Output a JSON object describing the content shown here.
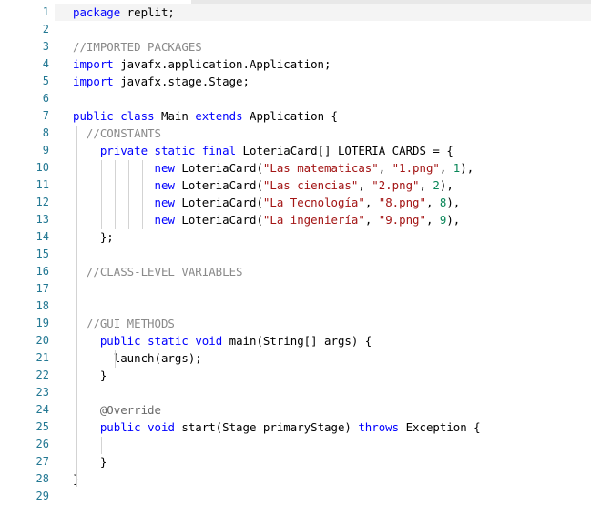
{
  "editor": {
    "line_numbers": [
      "1",
      "2",
      "3",
      "4",
      "5",
      "6",
      "7",
      "8",
      "9",
      "10",
      "11",
      "12",
      "13",
      "14",
      "15",
      "16",
      "17",
      "18",
      "19",
      "20",
      "21",
      "22",
      "23",
      "24",
      "25",
      "26",
      "27",
      "28",
      "29"
    ],
    "lines": [
      {
        "n": 1,
        "tokens": [
          {
            "t": "package",
            "k": "kw"
          },
          {
            "t": " replit;",
            "k": "plain"
          }
        ]
      },
      {
        "n": 2,
        "tokens": []
      },
      {
        "n": 3,
        "tokens": [
          {
            "t": "//IMPORTED PACKAGES",
            "k": "cm"
          }
        ]
      },
      {
        "n": 4,
        "tokens": [
          {
            "t": "import",
            "k": "kw"
          },
          {
            "t": " javafx.application.Application;",
            "k": "plain"
          }
        ]
      },
      {
        "n": 5,
        "tokens": [
          {
            "t": "import",
            "k": "kw"
          },
          {
            "t": " javafx.stage.Stage;",
            "k": "plain"
          }
        ]
      },
      {
        "n": 6,
        "tokens": []
      },
      {
        "n": 7,
        "tokens": [
          {
            "t": "public",
            "k": "kw"
          },
          {
            "t": " ",
            "k": "plain"
          },
          {
            "t": "class",
            "k": "kw"
          },
          {
            "t": " Main ",
            "k": "plain"
          },
          {
            "t": "extends",
            "k": "kw"
          },
          {
            "t": " Application {",
            "k": "plain"
          }
        ]
      },
      {
        "n": 8,
        "tokens": [
          {
            "t": "  //CONSTANTS",
            "k": "cm"
          }
        ]
      },
      {
        "n": 9,
        "tokens": [
          {
            "t": "    ",
            "k": "plain"
          },
          {
            "t": "private",
            "k": "kw"
          },
          {
            "t": " ",
            "k": "plain"
          },
          {
            "t": "static",
            "k": "kw"
          },
          {
            "t": " ",
            "k": "plain"
          },
          {
            "t": "final",
            "k": "kw"
          },
          {
            "t": " LoteriaCard[] LOTERIA_CARDS = {",
            "k": "plain"
          }
        ]
      },
      {
        "n": 10,
        "tokens": [
          {
            "t": "            ",
            "k": "plain"
          },
          {
            "t": "new",
            "k": "kw"
          },
          {
            "t": " LoteriaCard(",
            "k": "plain"
          },
          {
            "t": "\"Las matematicas\"",
            "k": "str"
          },
          {
            "t": ", ",
            "k": "plain"
          },
          {
            "t": "\"1.png\"",
            "k": "str"
          },
          {
            "t": ", ",
            "k": "plain"
          },
          {
            "t": "1",
            "k": "num"
          },
          {
            "t": "),",
            "k": "plain"
          }
        ]
      },
      {
        "n": 11,
        "tokens": [
          {
            "t": "            ",
            "k": "plain"
          },
          {
            "t": "new",
            "k": "kw"
          },
          {
            "t": " LoteriaCard(",
            "k": "plain"
          },
          {
            "t": "\"Las ciencias\"",
            "k": "str"
          },
          {
            "t": ", ",
            "k": "plain"
          },
          {
            "t": "\"2.png\"",
            "k": "str"
          },
          {
            "t": ", ",
            "k": "plain"
          },
          {
            "t": "2",
            "k": "num"
          },
          {
            "t": "),",
            "k": "plain"
          }
        ]
      },
      {
        "n": 12,
        "tokens": [
          {
            "t": "            ",
            "k": "plain"
          },
          {
            "t": "new",
            "k": "kw"
          },
          {
            "t": " LoteriaCard(",
            "k": "plain"
          },
          {
            "t": "\"La Tecnología\"",
            "k": "str"
          },
          {
            "t": ", ",
            "k": "plain"
          },
          {
            "t": "\"8.png\"",
            "k": "str"
          },
          {
            "t": ", ",
            "k": "plain"
          },
          {
            "t": "8",
            "k": "num"
          },
          {
            "t": "),",
            "k": "plain"
          }
        ]
      },
      {
        "n": 13,
        "tokens": [
          {
            "t": "            ",
            "k": "plain"
          },
          {
            "t": "new",
            "k": "kw"
          },
          {
            "t": " LoteriaCard(",
            "k": "plain"
          },
          {
            "t": "\"La ingeniería\"",
            "k": "str"
          },
          {
            "t": ", ",
            "k": "plain"
          },
          {
            "t": "\"9.png\"",
            "k": "str"
          },
          {
            "t": ", ",
            "k": "plain"
          },
          {
            "t": "9",
            "k": "num"
          },
          {
            "t": "),",
            "k": "plain"
          }
        ]
      },
      {
        "n": 14,
        "tokens": [
          {
            "t": "    };",
            "k": "plain"
          }
        ]
      },
      {
        "n": 15,
        "tokens": []
      },
      {
        "n": 16,
        "tokens": [
          {
            "t": "  //CLASS-LEVEL VARIABLES",
            "k": "cm"
          }
        ]
      },
      {
        "n": 17,
        "tokens": []
      },
      {
        "n": 18,
        "tokens": []
      },
      {
        "n": 19,
        "tokens": [
          {
            "t": "  //GUI METHODS",
            "k": "cm"
          }
        ]
      },
      {
        "n": 20,
        "tokens": [
          {
            "t": "    ",
            "k": "plain"
          },
          {
            "t": "public",
            "k": "kw"
          },
          {
            "t": " ",
            "k": "plain"
          },
          {
            "t": "static",
            "k": "kw"
          },
          {
            "t": " ",
            "k": "plain"
          },
          {
            "t": "void",
            "k": "kw"
          },
          {
            "t": " main(String[] args) {",
            "k": "plain"
          }
        ]
      },
      {
        "n": 21,
        "tokens": [
          {
            "t": "      launch(args);",
            "k": "plain"
          }
        ]
      },
      {
        "n": 22,
        "tokens": [
          {
            "t": "    }",
            "k": "plain"
          }
        ]
      },
      {
        "n": 23,
        "tokens": []
      },
      {
        "n": 24,
        "tokens": [
          {
            "t": "    @Override",
            "k": "an"
          }
        ]
      },
      {
        "n": 25,
        "tokens": [
          {
            "t": "    ",
            "k": "plain"
          },
          {
            "t": "public",
            "k": "kw"
          },
          {
            "t": " ",
            "k": "plain"
          },
          {
            "t": "void",
            "k": "kw"
          },
          {
            "t": " start(Stage primaryStage) ",
            "k": "plain"
          },
          {
            "t": "throws",
            "k": "kw"
          },
          {
            "t": " Exception {",
            "k": "plain"
          }
        ]
      },
      {
        "n": 26,
        "tokens": []
      },
      {
        "n": 27,
        "tokens": [
          {
            "t": "    }",
            "k": "plain"
          }
        ]
      },
      {
        "n": 28,
        "tokens": [
          {
            "t": "}",
            "k": "plain"
          }
        ]
      },
      {
        "n": 29,
        "tokens": []
      }
    ],
    "colors": {
      "keyword": "#0000ff",
      "string": "#a31515",
      "number": "#098658",
      "comment": "#8a8a8a",
      "line_number": "#237893",
      "indent_guide": "#d3d3d3",
      "current_line": "#f4f4f4"
    }
  }
}
